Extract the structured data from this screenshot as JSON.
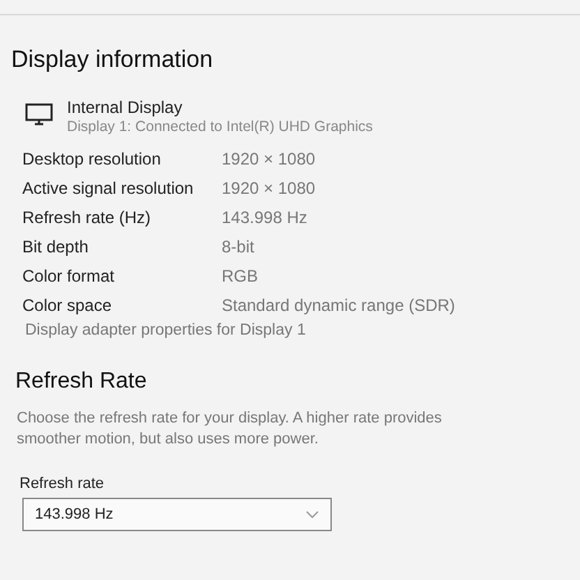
{
  "heading": "Display information",
  "display": {
    "name": "Internal Display",
    "subtitle": "Display 1: Connected to Intel(R) UHD Graphics"
  },
  "properties": [
    {
      "label": "Desktop resolution",
      "value": "1920 × 1080"
    },
    {
      "label": "Active signal resolution",
      "value": "1920 × 1080"
    },
    {
      "label": "Refresh rate (Hz)",
      "value": "143.998 Hz"
    },
    {
      "label": "Bit depth",
      "value": "8-bit"
    },
    {
      "label": "Color format",
      "value": "RGB"
    },
    {
      "label": "Color space",
      "value": "Standard dynamic range (SDR)"
    }
  ],
  "adapter_link": "Display adapter properties for Display 1",
  "refresh_section": {
    "title": "Refresh Rate",
    "description": "Choose the refresh rate for your display. A higher rate provides smoother motion, but also uses more power.",
    "field_label": "Refresh rate",
    "dropdown_value": "143.998 Hz"
  }
}
